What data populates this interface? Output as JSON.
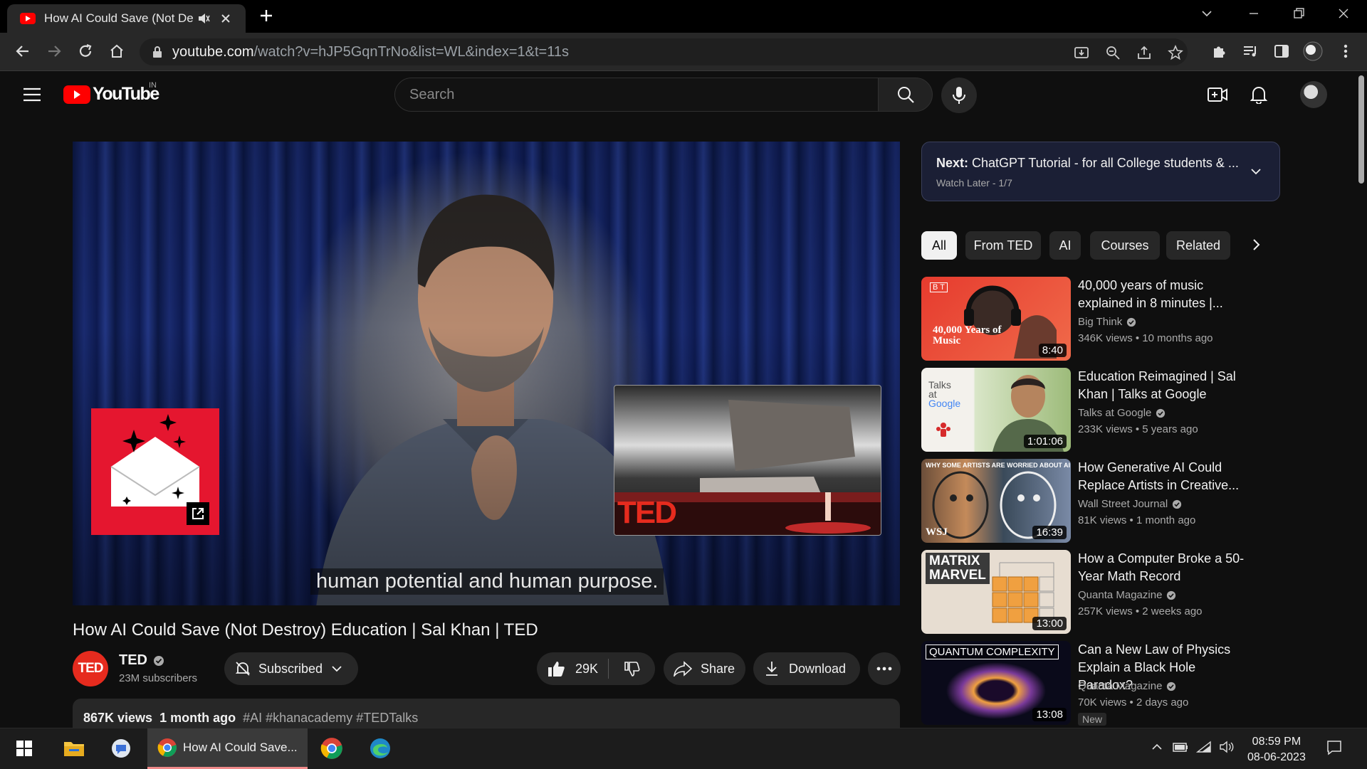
{
  "browser": {
    "tab_title": "How AI Could Save (Not Destroy) Education | Sal Khan | TED",
    "url_host": "youtube.com",
    "url_path": "/watch?v=hJP5GqnTrNo&list=WL&index=1&t=11s"
  },
  "header": {
    "logo_text": "YouTube",
    "country_code": "IN",
    "search_placeholder": "Search"
  },
  "player": {
    "subtitle": "human potential and human purpose.",
    "endscreen_brand": "TED"
  },
  "video": {
    "title": "How AI Could Save (Not Destroy) Education | Sal Khan | TED",
    "channel_avatar_text": "TED",
    "channel_name": "TED",
    "subscribers": "23M subscribers",
    "subscribed_label": "Subscribed",
    "likes": "29K",
    "share_label": "Share",
    "download_label": "Download",
    "views": "867K views",
    "age": "1 month ago",
    "tags": "#AI #khanacademy #TEDTalks"
  },
  "playlist": {
    "next_prefix": "Next:",
    "next_title": "ChatGPT Tutorial - for all College students & ...",
    "position": "Watch Later - 1/7"
  },
  "chips": [
    "All",
    "From TED",
    "AI",
    "Courses",
    "Related"
  ],
  "recommendations": [
    {
      "title": "40,000 years of music explained in 8 minutes |...",
      "channel": "Big Think",
      "stats": "346K views  • 10 months ago",
      "duration": "8:40",
      "thumb_text": "40,000 Years of Music",
      "thumb_logo": "B T"
    },
    {
      "title": "Education Reimagined | Sal Khan | Talks at Google",
      "channel": "Talks at Google",
      "stats": "233K views  • 5 years ago",
      "duration": "1:01:06",
      "thumb_text_1": "Talks",
      "thumb_text_2": "at",
      "thumb_text_3": "Google"
    },
    {
      "title": "How Generative AI Could Replace Artists in Creative...",
      "channel": "Wall Street Journal",
      "stats": "81K views  • 1 month ago",
      "duration": "16:39",
      "thumb_text": "WHY SOME ARTISTS ARE WORRIED ABOUT AI",
      "thumb_logo": "WSJ"
    },
    {
      "title": "How a Computer Broke a 50-Year Math Record",
      "channel": "Quanta Magazine",
      "stats": "257K views  • 2 weeks ago",
      "duration": "13:00",
      "thumb_text_1": "MATRIX",
      "thumb_text_2": "MARVEL"
    },
    {
      "title": "Can a New Law of Physics Explain a Black Hole Paradox?",
      "channel": "Quanta Magazine",
      "stats": "70K views  • 2 days ago",
      "duration": "13:08",
      "thumb_text": "QUANTUM COMPLEXITY",
      "badge": "New"
    }
  ],
  "taskbar": {
    "active_label": "How AI Could Save...",
    "time": "08:59 PM",
    "date": "08-06-2023"
  },
  "colors": {
    "youtube_red": "#ff0000",
    "ted_red": "#e62b1e",
    "background": "#0f0f0f"
  }
}
